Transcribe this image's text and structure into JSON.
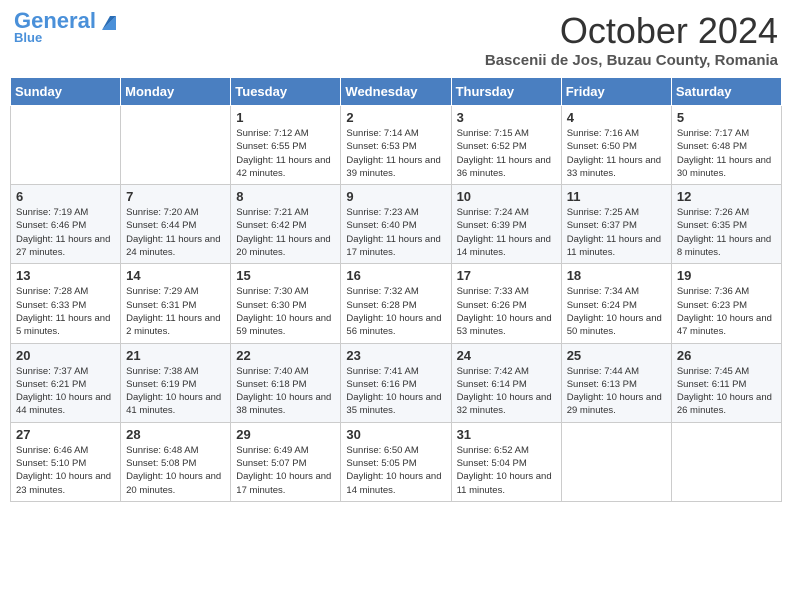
{
  "header": {
    "logo_general": "General",
    "logo_blue": "Blue",
    "month_title": "October 2024",
    "subtitle": "Bascenii de Jos, Buzau County, Romania"
  },
  "weekdays": [
    "Sunday",
    "Monday",
    "Tuesday",
    "Wednesday",
    "Thursday",
    "Friday",
    "Saturday"
  ],
  "weeks": [
    [
      null,
      null,
      {
        "day": "1",
        "sunrise": "Sunrise: 7:12 AM",
        "sunset": "Sunset: 6:55 PM",
        "daylight": "Daylight: 11 hours and 42 minutes."
      },
      {
        "day": "2",
        "sunrise": "Sunrise: 7:14 AM",
        "sunset": "Sunset: 6:53 PM",
        "daylight": "Daylight: 11 hours and 39 minutes."
      },
      {
        "day": "3",
        "sunrise": "Sunrise: 7:15 AM",
        "sunset": "Sunset: 6:52 PM",
        "daylight": "Daylight: 11 hours and 36 minutes."
      },
      {
        "day": "4",
        "sunrise": "Sunrise: 7:16 AM",
        "sunset": "Sunset: 6:50 PM",
        "daylight": "Daylight: 11 hours and 33 minutes."
      },
      {
        "day": "5",
        "sunrise": "Sunrise: 7:17 AM",
        "sunset": "Sunset: 6:48 PM",
        "daylight": "Daylight: 11 hours and 30 minutes."
      }
    ],
    [
      {
        "day": "6",
        "sunrise": "Sunrise: 7:19 AM",
        "sunset": "Sunset: 6:46 PM",
        "daylight": "Daylight: 11 hours and 27 minutes."
      },
      {
        "day": "7",
        "sunrise": "Sunrise: 7:20 AM",
        "sunset": "Sunset: 6:44 PM",
        "daylight": "Daylight: 11 hours and 24 minutes."
      },
      {
        "day": "8",
        "sunrise": "Sunrise: 7:21 AM",
        "sunset": "Sunset: 6:42 PM",
        "daylight": "Daylight: 11 hours and 20 minutes."
      },
      {
        "day": "9",
        "sunrise": "Sunrise: 7:23 AM",
        "sunset": "Sunset: 6:40 PM",
        "daylight": "Daylight: 11 hours and 17 minutes."
      },
      {
        "day": "10",
        "sunrise": "Sunrise: 7:24 AM",
        "sunset": "Sunset: 6:39 PM",
        "daylight": "Daylight: 11 hours and 14 minutes."
      },
      {
        "day": "11",
        "sunrise": "Sunrise: 7:25 AM",
        "sunset": "Sunset: 6:37 PM",
        "daylight": "Daylight: 11 hours and 11 minutes."
      },
      {
        "day": "12",
        "sunrise": "Sunrise: 7:26 AM",
        "sunset": "Sunset: 6:35 PM",
        "daylight": "Daylight: 11 hours and 8 minutes."
      }
    ],
    [
      {
        "day": "13",
        "sunrise": "Sunrise: 7:28 AM",
        "sunset": "Sunset: 6:33 PM",
        "daylight": "Daylight: 11 hours and 5 minutes."
      },
      {
        "day": "14",
        "sunrise": "Sunrise: 7:29 AM",
        "sunset": "Sunset: 6:31 PM",
        "daylight": "Daylight: 11 hours and 2 minutes."
      },
      {
        "day": "15",
        "sunrise": "Sunrise: 7:30 AM",
        "sunset": "Sunset: 6:30 PM",
        "daylight": "Daylight: 10 hours and 59 minutes."
      },
      {
        "day": "16",
        "sunrise": "Sunrise: 7:32 AM",
        "sunset": "Sunset: 6:28 PM",
        "daylight": "Daylight: 10 hours and 56 minutes."
      },
      {
        "day": "17",
        "sunrise": "Sunrise: 7:33 AM",
        "sunset": "Sunset: 6:26 PM",
        "daylight": "Daylight: 10 hours and 53 minutes."
      },
      {
        "day": "18",
        "sunrise": "Sunrise: 7:34 AM",
        "sunset": "Sunset: 6:24 PM",
        "daylight": "Daylight: 10 hours and 50 minutes."
      },
      {
        "day": "19",
        "sunrise": "Sunrise: 7:36 AM",
        "sunset": "Sunset: 6:23 PM",
        "daylight": "Daylight: 10 hours and 47 minutes."
      }
    ],
    [
      {
        "day": "20",
        "sunrise": "Sunrise: 7:37 AM",
        "sunset": "Sunset: 6:21 PM",
        "daylight": "Daylight: 10 hours and 44 minutes."
      },
      {
        "day": "21",
        "sunrise": "Sunrise: 7:38 AM",
        "sunset": "Sunset: 6:19 PM",
        "daylight": "Daylight: 10 hours and 41 minutes."
      },
      {
        "day": "22",
        "sunrise": "Sunrise: 7:40 AM",
        "sunset": "Sunset: 6:18 PM",
        "daylight": "Daylight: 10 hours and 38 minutes."
      },
      {
        "day": "23",
        "sunrise": "Sunrise: 7:41 AM",
        "sunset": "Sunset: 6:16 PM",
        "daylight": "Daylight: 10 hours and 35 minutes."
      },
      {
        "day": "24",
        "sunrise": "Sunrise: 7:42 AM",
        "sunset": "Sunset: 6:14 PM",
        "daylight": "Daylight: 10 hours and 32 minutes."
      },
      {
        "day": "25",
        "sunrise": "Sunrise: 7:44 AM",
        "sunset": "Sunset: 6:13 PM",
        "daylight": "Daylight: 10 hours and 29 minutes."
      },
      {
        "day": "26",
        "sunrise": "Sunrise: 7:45 AM",
        "sunset": "Sunset: 6:11 PM",
        "daylight": "Daylight: 10 hours and 26 minutes."
      }
    ],
    [
      {
        "day": "27",
        "sunrise": "Sunrise: 6:46 AM",
        "sunset": "Sunset: 5:10 PM",
        "daylight": "Daylight: 10 hours and 23 minutes."
      },
      {
        "day": "28",
        "sunrise": "Sunrise: 6:48 AM",
        "sunset": "Sunset: 5:08 PM",
        "daylight": "Daylight: 10 hours and 20 minutes."
      },
      {
        "day": "29",
        "sunrise": "Sunrise: 6:49 AM",
        "sunset": "Sunset: 5:07 PM",
        "daylight": "Daylight: 10 hours and 17 minutes."
      },
      {
        "day": "30",
        "sunrise": "Sunrise: 6:50 AM",
        "sunset": "Sunset: 5:05 PM",
        "daylight": "Daylight: 10 hours and 14 minutes."
      },
      {
        "day": "31",
        "sunrise": "Sunrise: 6:52 AM",
        "sunset": "Sunset: 5:04 PM",
        "daylight": "Daylight: 10 hours and 11 minutes."
      },
      null,
      null
    ]
  ]
}
